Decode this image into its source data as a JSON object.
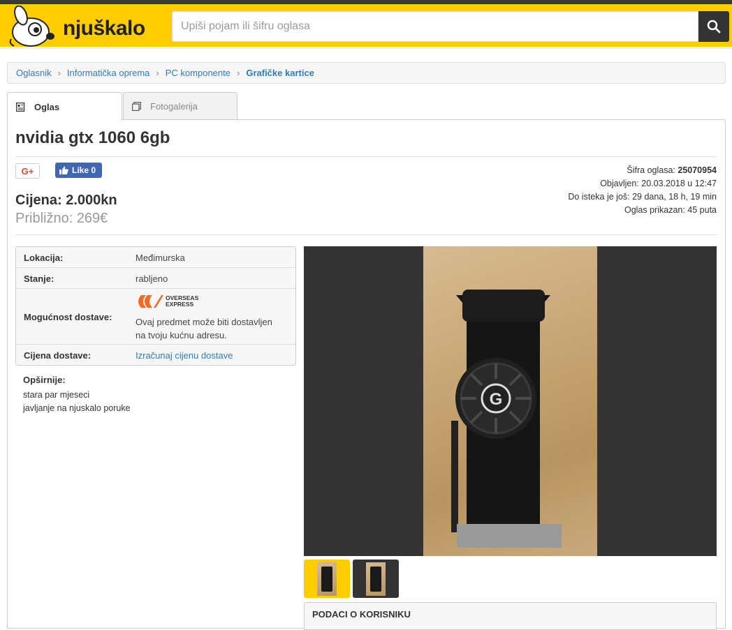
{
  "header": {
    "logo_text": "njuškalo",
    "search_placeholder": "Upiši pojam ili šifru oglasa"
  },
  "breadcrumb": [
    "Oglasnik",
    "Informatička oprema",
    "PC komponente",
    "Grafičke kartice"
  ],
  "tabs": [
    {
      "label": "Oglas",
      "active": true
    },
    {
      "label": "Fotogalerija",
      "active": false
    }
  ],
  "ad": {
    "title": "nvidia gtx 1060 6gb",
    "gplus_label": "G+",
    "like_label": "Like 0",
    "price": "Cijena: 2.000kn",
    "approx": "Približno: 269€",
    "code_label": "Šifra oglasa:",
    "code_value": "25070954",
    "published": "Objavljen: 20.03.2018 u 12:47",
    "expires": "Do isteka je još: 29 dana, 18 h, 19 min",
    "views": "Oglas prikazan: 45 puta"
  },
  "details": {
    "location_label": "Lokacija:",
    "location_value": "Međimurska",
    "condition_label": "Stanje:",
    "condition_value": "rabljeno",
    "delivery_label": "Mogućnost dostave:",
    "delivery_logo_line1": "OVERSEAS",
    "delivery_logo_line2": "EXPRESS",
    "delivery_text_1": "Ovaj predmet može biti dostavljen",
    "delivery_text_2": "na tvoju kućnu adresu.",
    "shipping_label": "Cijena dostave:",
    "shipping_link": "Izračunaj cijenu dostave"
  },
  "description": {
    "title": "Opširnije:",
    "line1": "stara par mjeseci",
    "line2": "javljanje na njuskalo poruke"
  },
  "user_box": {
    "title": "PODACI O KORISNIKU"
  },
  "colors": {
    "brand_yellow": "#ffcc00",
    "link_blue": "#2d7cb7",
    "facebook_blue": "#4267b2"
  }
}
